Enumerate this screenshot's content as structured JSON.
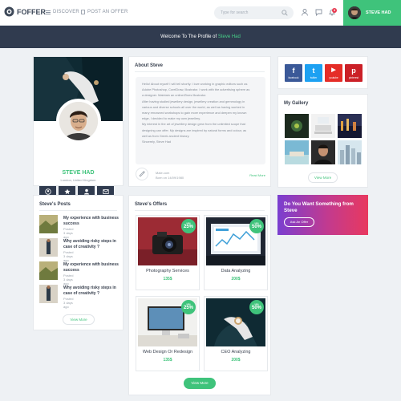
{
  "nav": {
    "brand": "FOFFER",
    "links": [
      "DISCOVER",
      "POST AN OFFER"
    ],
    "search_placeholder": "Type for search",
    "notification_count": "3",
    "user_name": "STEVE HAD"
  },
  "banner": {
    "prefix": "Welcome To The Profile of",
    "name": "Steve Had"
  },
  "profile": {
    "name": "STEVE HAD",
    "location": "London, United Kingdom",
    "buttons": [
      "profile",
      "favorite",
      "follow",
      "contact"
    ]
  },
  "about": {
    "title": "About Steve",
    "paragraphs": [
      "Hello! About myself I will tell shortly. I love working in graphic editors such as",
      "Adobe Photoshop, CorelDraw, Illustrator. I work with the advertising sphere as",
      "a designer. Maintain an online/Zines Illustrator.",
      "After having studied jewellery design, jewellery creation and gemmology in",
      "various and diverse schools all over the world, as well as having worked in",
      "many renowned workshops to gain more experience and deepen my known",
      "edge, I decided to make my own jewellery.",
      "My interest in the art of jewellery design grew from the unlimited scope that",
      "designing can offer. My designs are inspired by natural forms and colour, as",
      "well as from Greek ancient history.",
      "Sincerely, Steve Had"
    ],
    "gender_label": "Male.com",
    "birthday": "Born on 14/09/1980",
    "read_more": "Read More"
  },
  "social": [
    {
      "glyph": "f",
      "label": "facebook",
      "color": "#3b5998"
    },
    {
      "glyph": "t",
      "label": "twitter",
      "color": "#1da1f2"
    },
    {
      "glyph": "▶",
      "label": "youtube",
      "color": "#e52d27"
    },
    {
      "glyph": "p",
      "label": "pinterest",
      "color": "#cb2027"
    }
  ],
  "gallery": {
    "title": "My Gallery",
    "view_more": "View More"
  },
  "posts": {
    "title": "Steve's Posts",
    "items": [
      {
        "title": "My experience with business success",
        "date": "Posted 3 days ago"
      },
      {
        "title": "Why avoiding risky steps in case of creativity ?",
        "date": "Posted 3 days ago"
      },
      {
        "title": "My experience with business success",
        "date": "Posted 3 days ago"
      },
      {
        "title": "Why avoiding risky steps in case of creativity ?",
        "date": "Posted 3 days ago"
      }
    ],
    "view_more": "View More"
  },
  "offers": {
    "title": "Steve's Offers",
    "items": [
      {
        "name": "Photography Services",
        "price": "135$",
        "sale_label": "sale",
        "discount": "25%"
      },
      {
        "name": "Data Analyzing",
        "price": "200$",
        "sale_label": "sale",
        "discount": "50%"
      },
      {
        "name": "Web Design Or Redesign",
        "price": "135$",
        "sale_label": "sale",
        "discount": "25%"
      },
      {
        "name": "CEO Analyzing",
        "price": "200$",
        "sale_label": "sale",
        "discount": "50%"
      }
    ],
    "view_more": "View More"
  },
  "promo": {
    "title": "Do You Want Something from Steve",
    "button": "Ask An Offer"
  },
  "colors": {
    "accent": "#3fc37b",
    "dark": "#303b4f"
  }
}
